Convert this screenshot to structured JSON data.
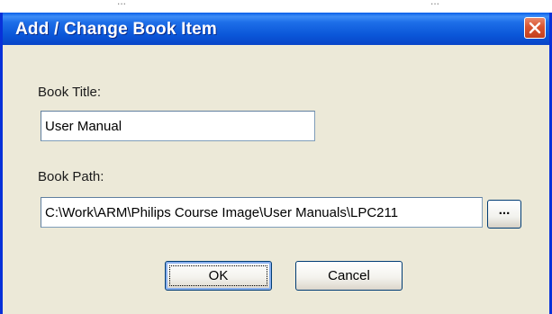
{
  "background_strip": {
    "left_text": "...",
    "right_text": "..."
  },
  "dialog": {
    "title": "Add / Change Book Item",
    "close_icon": "close-x",
    "book_title_label": "Book Title:",
    "book_title_value": "User Manual",
    "book_path_label": "Book Path:",
    "book_path_value": "C:\\Work\\ARM\\Philips Course Image\\User Manuals\\LPC211",
    "browse_label": "...",
    "ok_label": "OK",
    "cancel_label": "Cancel"
  },
  "colors": {
    "titlebar": "#0a56d8",
    "frame": "#0831d9",
    "close": "#d9542f",
    "dialog_bg": "#ece9d8"
  }
}
